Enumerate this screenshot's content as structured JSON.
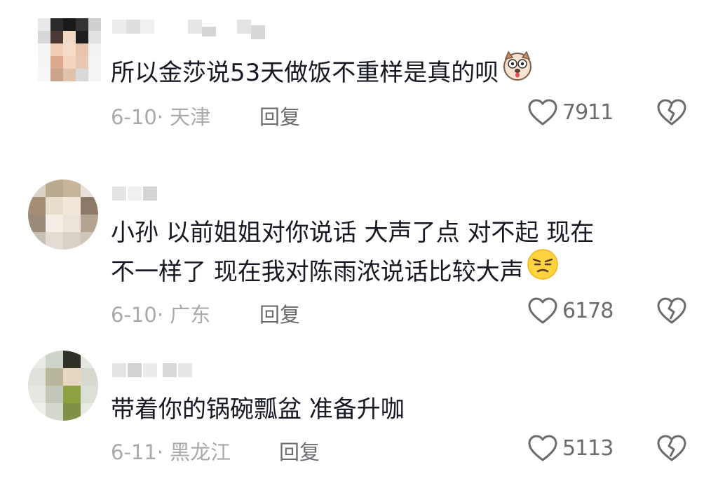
{
  "comments": [
    {
      "text_lines": [
        "所以金莎说53天做饭不重样是真的呗"
      ],
      "emoji": "dog-face-emoji",
      "date": "6-10",
      "location": "天津",
      "reply_label": "回复",
      "likes": "7911"
    },
    {
      "text_lines": [
        "小孙 以前姐姐对你说话 大声了点 对不起 现在",
        "不一样了 现在我对陈雨浓说话比较大声"
      ],
      "emoji": "smirk-face-emoji",
      "date": "6-10",
      "location": "广东",
      "reply_label": "回复",
      "likes": "6178"
    },
    {
      "text_lines": [
        "带着你的锅碗瓢盆 准备升咖"
      ],
      "emoji": "",
      "date": "6-11",
      "location": "黑龙江",
      "reply_label": "回复",
      "likes": "5113"
    }
  ],
  "colors": {
    "text": "#161823",
    "meta": "#a9a9ad",
    "action": "#6b6b70"
  },
  "icons": [
    "like-heart-icon",
    "dislike-broken-heart-icon"
  ]
}
